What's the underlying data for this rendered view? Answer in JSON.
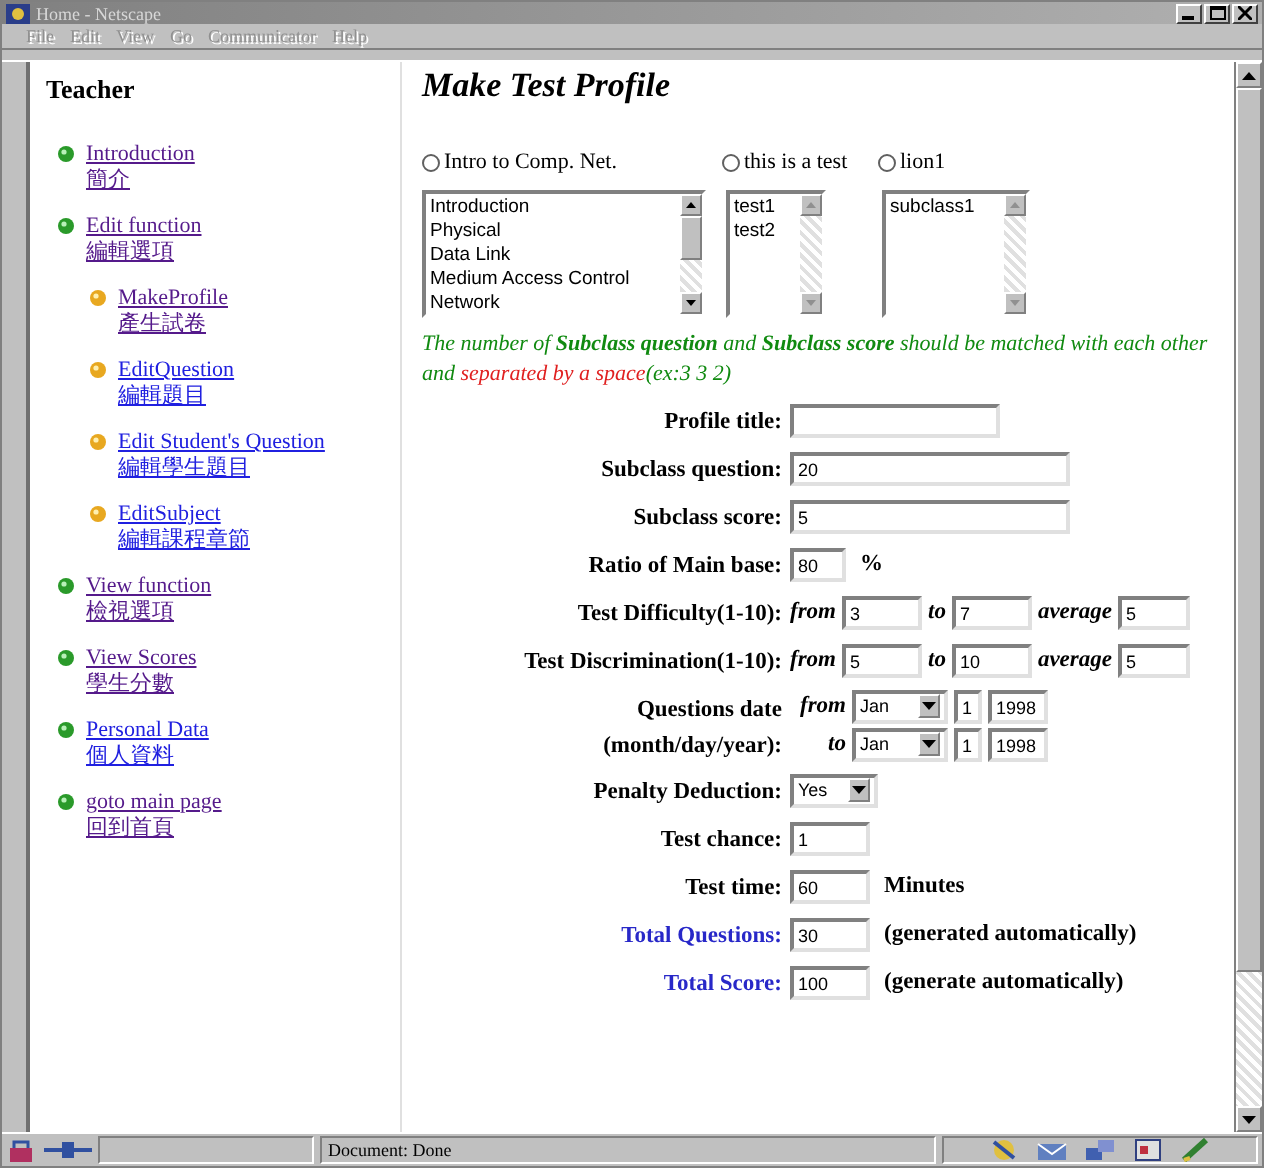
{
  "window": {
    "title": "Home - Netscape"
  },
  "menu": [
    {
      "label": "File"
    },
    {
      "label": "Edit"
    },
    {
      "label": "View"
    },
    {
      "label": "Go"
    },
    {
      "label": "Communicator"
    },
    {
      "label": "Help"
    }
  ],
  "sidebar": {
    "heading": "Teacher",
    "items": [
      {
        "label": "Introduction",
        "subtitle": "簡介",
        "visited": true
      },
      {
        "label": "Edit function",
        "subtitle": "編輯選項",
        "visited": true,
        "children": [
          {
            "label": "MakeProfile",
            "subtitle": "產生試卷",
            "visited": true
          },
          {
            "label": "EditQuestion",
            "subtitle": "編輯題目",
            "visited": false
          },
          {
            "label": "Edit Student's Question",
            "subtitle": "編輯學生題目",
            "visited": false
          },
          {
            "label": "EditSubject",
            "subtitle": "編輯課程章節",
            "visited": false
          }
        ]
      },
      {
        "label": "View function",
        "subtitle": "檢視選項",
        "visited": true
      },
      {
        "label": "View Scores",
        "subtitle": "學生分數",
        "visited": true
      },
      {
        "label": "Personal Data",
        "subtitle": "個人資料",
        "visited": false
      },
      {
        "label": "goto main page",
        "subtitle": "回到首頁",
        "visited": true
      }
    ]
  },
  "page": {
    "title": "Make Test Profile",
    "subjects": [
      {
        "label": "Intro to Comp. Net.",
        "selected": false,
        "items": [
          "Introduction",
          "Physical",
          "Data Link",
          "Medium Access Control",
          "Network"
        ]
      },
      {
        "label": "this is a test",
        "selected": false,
        "items": [
          "test1",
          "test2"
        ]
      },
      {
        "label": "lion1",
        "selected": false,
        "items": [
          "subclass1"
        ]
      }
    ],
    "note": [
      {
        "kind": "plain",
        "text": "The number of **Subclass question** and **Subclass score** should be matched with each other and "
      },
      {
        "kind": "warning",
        "text": "separated by a space"
      },
      {
        "kind": "plain",
        "text": "(ex:3 3 2)"
      }
    ],
    "rows": [
      {
        "kind": "text",
        "label": "Profile title:",
        "auto": false
      },
      {
        "kind": "text",
        "label": "Subclass question:",
        "value": "20",
        "auto": false
      },
      {
        "kind": "text",
        "label": "Subclass score:",
        "value": "5",
        "auto": false
      },
      {
        "kind": "text",
        "label": "Ratio of Main base:",
        "value": "80",
        "suffix": "%",
        "auto": false
      },
      {
        "kind": "range",
        "label": "Test Difficulty(1-10):",
        "from_label": "from",
        "from": "3",
        "to_label": "to",
        "to": "7",
        "average_label": "average",
        "average": "5"
      },
      {
        "kind": "range",
        "label": "Test Discrimination(1-10):",
        "from_label": "from",
        "from": "5",
        "to_label": "to",
        "to": "10",
        "average_label": "average",
        "average": "5"
      },
      {
        "kind": "date",
        "label": "Questions date",
        "label_2": "(month/day/year):",
        "from_label": "from",
        "from": {
          "month": "Jan",
          "day": "1",
          "year": "1998"
        },
        "to_label": "to",
        "to": {
          "month": "Jan",
          "day": "1",
          "year": "1998"
        }
      },
      {
        "kind": "select",
        "label": "Penalty Deduction:",
        "value": "Yes"
      },
      {
        "kind": "text",
        "label": "Test chance:",
        "value": "1",
        "auto": false
      },
      {
        "kind": "text",
        "label": "Test time:",
        "value": "60",
        "suffix": "Minutes",
        "auto": false
      },
      {
        "kind": "text",
        "label": "Total Questions:",
        "value": "30",
        "suffix": "(generated automatically)",
        "auto": true
      },
      {
        "kind": "text",
        "label": "Total Score:",
        "value": "100",
        "suffix": "(generate automatically)",
        "auto": true
      }
    ]
  },
  "status_bar": {
    "text": "Document: Done"
  }
}
